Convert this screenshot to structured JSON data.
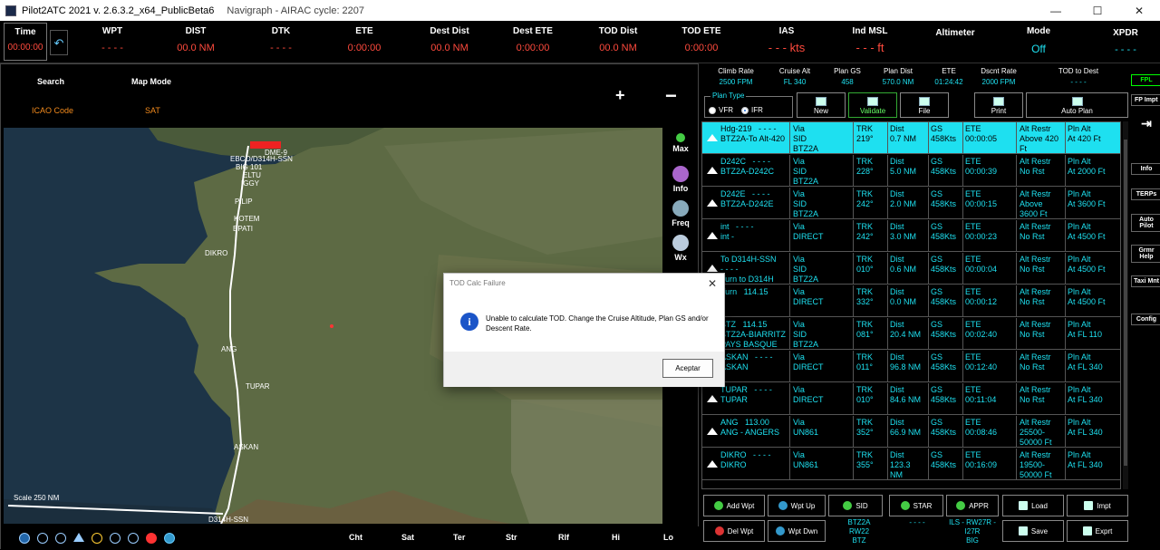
{
  "window": {
    "title": "Pilot2ATC 2021 v. 2.6.3.2_x64_PublicBeta6",
    "subtitle": "Navigraph - AIRAC cycle: 2207",
    "min": "—",
    "max": "☐",
    "close": "✕"
  },
  "topbar": {
    "time": {
      "label": "Time",
      "value": "00:00:00"
    },
    "cells": [
      {
        "label": "WPT",
        "value": "- - - -"
      },
      {
        "label": "DIST",
        "value": "00.0 NM"
      },
      {
        "label": "DTK",
        "value": "- - - -"
      },
      {
        "label": "ETE",
        "value": "0:00:00"
      },
      {
        "label": "Dest Dist",
        "value": "00.0 NM"
      },
      {
        "label": "Dest ETE",
        "value": "0:00:00"
      },
      {
        "label": "TOD Dist",
        "value": "00.0 NM"
      },
      {
        "label": "TOD ETE",
        "value": "0:00:00"
      },
      {
        "label": "IAS",
        "value": "- - - kts"
      },
      {
        "label": "Ind MSL",
        "value": "- - - ft"
      },
      {
        "label": "Altimeter",
        "value": ""
      },
      {
        "label": "Mode",
        "value": "Off"
      },
      {
        "label": "XPDR",
        "value": "- - - -"
      }
    ]
  },
  "map": {
    "search_label": "Search",
    "mapmode_label": "Map Mode",
    "icao_label": "ICAO Code",
    "sat_label": "SAT",
    "zoom_in": "+",
    "zoom_out": "−",
    "scale_label": "Scale 250 NM",
    "waypoints": [
      "EBCO/D314H-SSN",
      "BIG 101",
      "ELTU",
      "IGGY",
      "PILIP",
      "KOTEM",
      "EPATI",
      "DIKRO",
      "ANG",
      "TUPAR",
      "ASKAN",
      "DME-9",
      "D314H-SSN"
    ],
    "side_tools": [
      "Max",
      "Info",
      "Freq",
      "Wx"
    ],
    "bottom_tabs": [
      "Cht",
      "Sat",
      "Ter",
      "Str",
      "Rlf",
      "Hi",
      "Lo"
    ]
  },
  "plan": {
    "summary": [
      {
        "label": "Climb Rate",
        "value": "2500 FPM"
      },
      {
        "label": "Cruise Alt",
        "value": "FL 340"
      },
      {
        "label": "Plan GS",
        "value": "458"
      },
      {
        "label": "Plan Dist",
        "value": "570.0 NM"
      },
      {
        "label": "ETE",
        "value": "01:24:42"
      },
      {
        "label": "Dscnt Rate",
        "value": "2000 FPM"
      },
      {
        "label": "TOD to Dest",
        "value": "- - - -"
      }
    ],
    "plan_type_legend": "Plan Type",
    "vfr": "VFR",
    "ifr": "IFR",
    "buttons": {
      "new": "New",
      "validate": "Validate",
      "file": "File",
      "print": "Print",
      "auto_plan": "Auto Plan"
    },
    "rows": [
      {
        "wpt": "Hdg-219   - - - -\nBTZ2A-To Alt-420",
        "via": "Via\nSID\nBTZ2A",
        "trk": "TRK\n219°",
        "dist": "Dist\n0.7 NM",
        "gs": "GS\n458Kts",
        "ete": "ETE\n00:00:05",
        "alt": "Alt Restr\nAbove 420\nFt",
        "pln": "Pln Alt\nAt 420 Ft",
        "sel": true
      },
      {
        "wpt": "D242C   - - - -\nBTZ2A-D242C",
        "via": "Via\nSID\nBTZ2A",
        "trk": "TRK\n228°",
        "dist": "Dist\n5.0 NM",
        "gs": "GS\n458Kts",
        "ete": "ETE\n00:00:39",
        "alt": "Alt Restr\nNo Rst",
        "pln": "Pln Alt\nAt 2000 Ft",
        "sel": false
      },
      {
        "wpt": "D242E   - - - -\nBTZ2A-D242E",
        "via": "Via\nSID\nBTZ2A",
        "trk": "TRK\n242°",
        "dist": "Dist\n2.0 NM",
        "gs": "GS\n458Kts",
        "ete": "ETE\n00:00:15",
        "alt": "Alt Restr\nAbove\n3600 Ft",
        "pln": "Pln Alt\nAt 3600 Ft",
        "sel": false
      },
      {
        "wpt": "int   - - - -\nint -",
        "via": "Via\nDIRECT",
        "trk": "TRK\n242°",
        "dist": "Dist\n3.0 NM",
        "gs": "GS\n458Kts",
        "ete": "ETE\n00:00:23",
        "alt": "Alt Restr\nNo Rst",
        "pln": "Pln Alt\nAt 4500 Ft",
        "sel": false
      },
      {
        "wpt": "To D314H-SSN\n- - - -\nTurn to D314H",
        "via": "Via\nSID\nBTZ2A",
        "trk": "TRK\n010°",
        "dist": "Dist\n0.6 NM",
        "gs": "GS\n458Kts",
        "ete": "ETE\n00:00:04",
        "alt": "Alt Restr\nNo Rst",
        "pln": "Pln Alt\nAt 4500 Ft",
        "sel": false
      },
      {
        "wpt": "Turn   114.15\n",
        "via": "Via\nDIRECT",
        "trk": "TRK\n332°",
        "dist": "Dist\n0.0 NM",
        "gs": "GS\n458Kts",
        "ete": "ETE\n00:00:12",
        "alt": "Alt Restr\nNo Rst",
        "pln": "Pln Alt\nAt 4500 Ft",
        "sel": false
      },
      {
        "wpt": "BTZ   114.15\nBTZ2A-BIARRITZ\nPAYS BASQUE",
        "via": "Via\nSID\nBTZ2A",
        "trk": "TRK\n081°",
        "dist": "Dist\n20.4 NM",
        "gs": "GS\n458Kts",
        "ete": "ETE\n00:02:40",
        "alt": "Alt Restr\nNo Rst",
        "pln": "Pln Alt\nAt FL 110",
        "sel": false
      },
      {
        "wpt": "ASKAN   - - - -\nASKAN",
        "via": "Via\nDIRECT",
        "trk": "TRK\n011°",
        "dist": "Dist\n96.8 NM",
        "gs": "GS\n458Kts",
        "ete": "ETE\n00:12:40",
        "alt": "Alt Restr\nNo Rst",
        "pln": "Pln Alt\nAt FL 340",
        "sel": false
      },
      {
        "wpt": "TUPAR   - - - -\nTUPAR",
        "via": "Via\nDIRECT",
        "trk": "TRK\n010°",
        "dist": "Dist\n84.6 NM",
        "gs": "GS\n458Kts",
        "ete": "ETE\n00:11:04",
        "alt": "Alt Restr\nNo Rst",
        "pln": "Pln Alt\nAt FL 340",
        "sel": false
      },
      {
        "wpt": "ANG   113.00\nANG - ANGERS",
        "via": "Via\nUN861",
        "trk": "TRK\n352°",
        "dist": "Dist\n66.9 NM",
        "gs": "GS\n458Kts",
        "ete": "ETE\n00:08:46",
        "alt": "Alt Restr\n25500-\n50000 Ft",
        "pln": "Pln Alt\nAt FL 340",
        "sel": false
      },
      {
        "wpt": "DIKRO   - - - -\nDIKRO",
        "via": "Via\nUN861",
        "trk": "TRK\n355°",
        "dist": "Dist\n123.3\nNM",
        "gs": "GS\n458Kts",
        "ete": "ETE\n00:16:09",
        "alt": "Alt Restr\n19500-\n50000 Ft",
        "pln": "Pln Alt\nAt FL 340",
        "sel": false
      }
    ],
    "actions": {
      "add_wpt": "Add Wpt",
      "wpt_up": "Wpt Up",
      "sid": "SID",
      "star": "STAR",
      "appr": "APPR",
      "load": "Load",
      "impt": "Impt",
      "del_wpt": "Del Wpt",
      "wpt_dwn": "Wpt Dwn",
      "save": "Save",
      "exprt": "Exprt"
    },
    "sid_value": "BTZ2A\nRW22\nBTZ",
    "star_value": "- - - -",
    "appr_value": "ILS - RW27R -\nI27R\nBIG"
  },
  "farright": [
    "FPL",
    "FP Impt",
    "Info",
    "TERPs",
    "Auto\nPilot",
    "Grmr\nHelp",
    "Taxi Mnt",
    "Config"
  ],
  "dialog": {
    "title": "TOD Calc Failure",
    "message": "Unable to calculate TOD.  Change the Cruise Altitude, Plan GS and/or Descent Rate.",
    "ok": "Aceptar",
    "close": "✕"
  }
}
